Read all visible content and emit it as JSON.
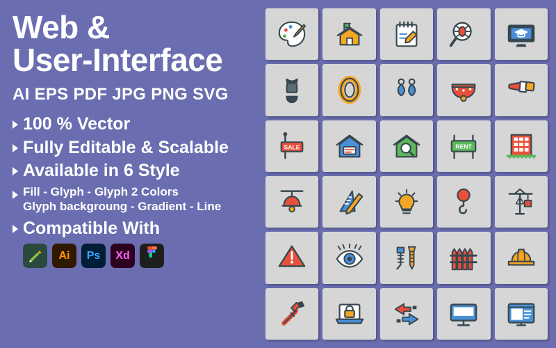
{
  "left": {
    "title_line1": "Web &",
    "title_line2": "User-Interface",
    "formats": "AI EPS PDF JPG PNG SVG",
    "bullets": [
      "100 % Vector",
      "Fully Editable & Scalable",
      "Available in 6 Style"
    ],
    "styles_line1": "Fill - Glyph - Glyph 2 Colors",
    "styles_line2": "Glyph backgroung - Gradient - Line",
    "compatible": "Compatible With",
    "apps": [
      {
        "name": "inkscape",
        "label": ""
      },
      {
        "name": "adobe-illustrator",
        "label": "Ai"
      },
      {
        "name": "adobe-photoshop",
        "label": "Ps"
      },
      {
        "name": "adobe-xd",
        "label": "Xd"
      },
      {
        "name": "figma",
        "label": ""
      }
    ]
  },
  "colors": {
    "background": "#6a6eb0",
    "tile": "#d6d6d6",
    "icon_outline": "#37474f",
    "accent_orange": "#f5a623",
    "accent_red": "#e8503a",
    "accent_blue": "#4a90d9",
    "accent_green": "#5cb85c"
  },
  "grid": {
    "rows": 6,
    "cols": 5,
    "icons": [
      "paint-palette-icon",
      "house-with-flag-icon",
      "notepad-pencil-icon",
      "magnifier-bug-icon",
      "monitor-graduation-icon",
      "swimsuit-icon",
      "bracelet-ring-icon",
      "earrings-icon",
      "dog-collar-icon",
      "lipstick-icon",
      "sale-sign-icon",
      "house-for-sale-icon",
      "house-search-icon",
      "rent-sign-icon",
      "office-building-icon",
      "ceiling-lamp-icon",
      "ruler-pencil-icon",
      "light-bulb-icon",
      "crane-hook-icon",
      "tower-crane-icon",
      "warning-triangle-icon",
      "eye-icon",
      "screw-bolt-icon",
      "fence-icon",
      "hard-hat-icon",
      "pipe-wrench-icon",
      "laptop-lock-icon",
      "arrows-exchange-icon",
      "desktop-monitor-icon",
      "browser-window-icon"
    ]
  }
}
